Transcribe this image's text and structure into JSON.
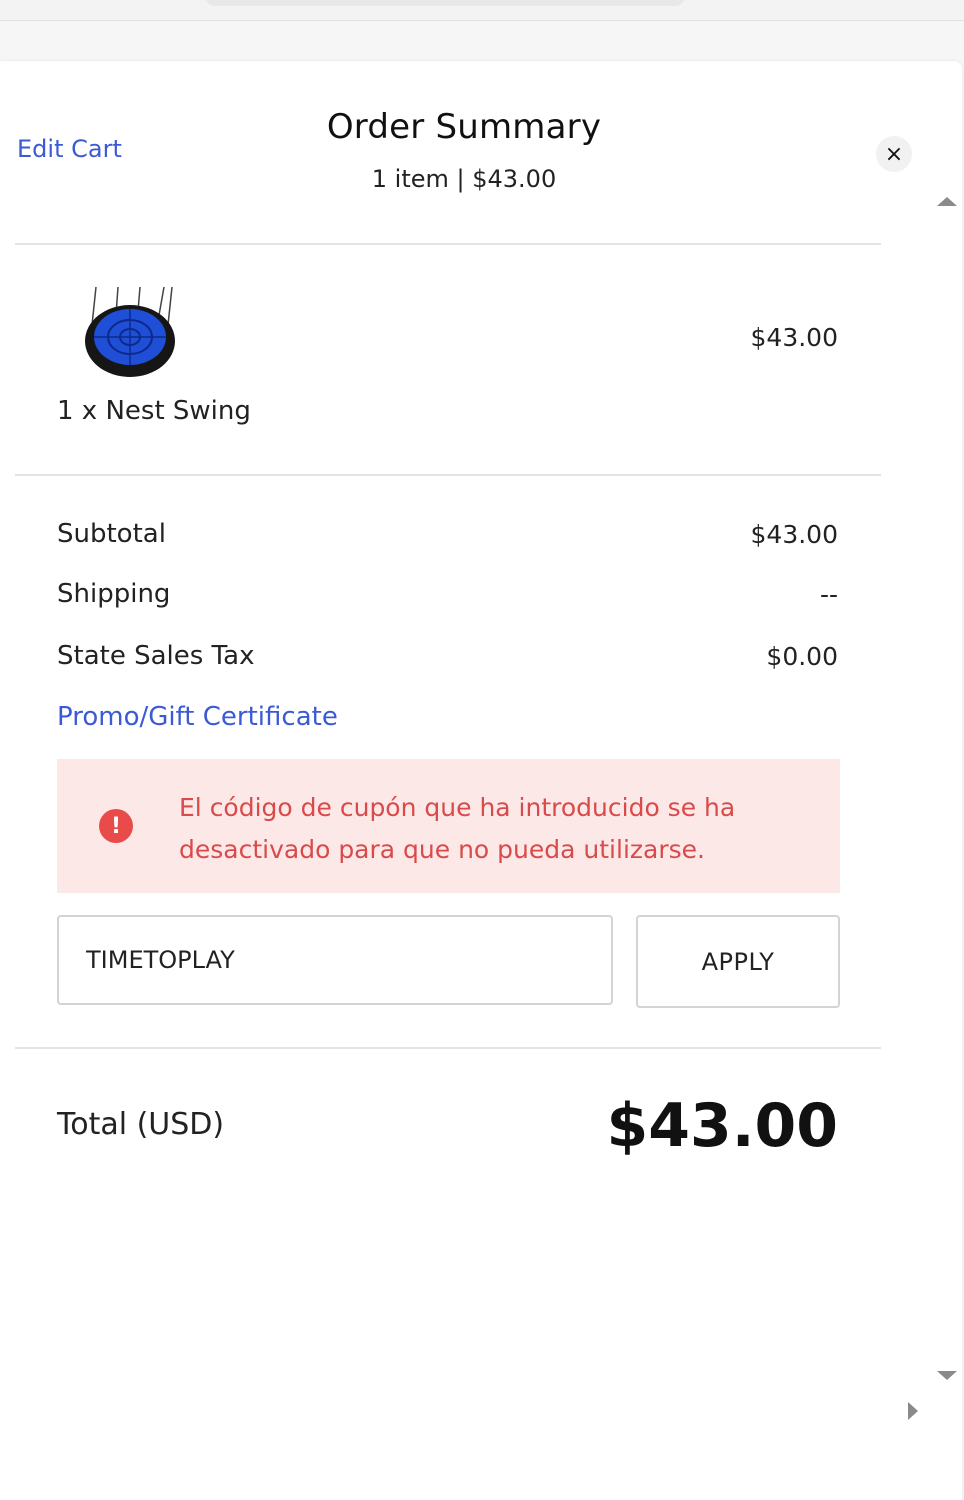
{
  "header": {
    "edit_cart": "Edit Cart",
    "title": "Order Summary",
    "subtitle": "1 item | $43.00",
    "close_glyph": "×"
  },
  "item": {
    "name": "1 x Nest Swing",
    "price": "$43.00",
    "image_icon": "nest-swing-image"
  },
  "totals": {
    "subtotal_label": "Subtotal",
    "subtotal_value": "$43.00",
    "shipping_label": "Shipping",
    "shipping_value": "--",
    "tax_label": "State Sales Tax",
    "tax_value": "$0.00"
  },
  "promo": {
    "link": "Promo/Gift Certificate",
    "error_icon": "!",
    "error_message": "El código de cupón que ha introducido se ha desactivado para que no pueda utilizarse.",
    "input_value": "TIMETOPLAY",
    "apply_label": "APPLY"
  },
  "grand_total": {
    "label": "Total (USD)",
    "value": "$43.00"
  },
  "colors": {
    "link": "#3b5bd6",
    "error_text": "#d94a4a",
    "error_bg": "#fde8e8",
    "error_icon": "#e94b4b"
  }
}
